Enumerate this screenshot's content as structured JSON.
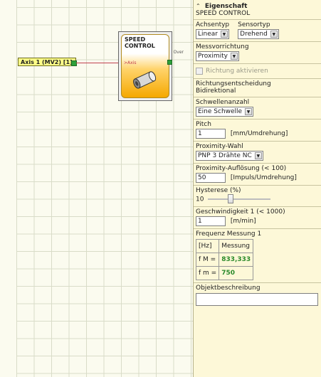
{
  "canvas": {
    "input_tag": "Axis 1 (MV2) [1]",
    "block": {
      "title_line1": "SPEED",
      "title_line2": "CONTROL",
      "input_pin": "Axis",
      "output_pin": "Over"
    }
  },
  "panel": {
    "header": {
      "collapse_icon": "chevron-up-icon",
      "title": "Eigenschaft",
      "subtitle": "SPEED CONTROL"
    },
    "achsentyp": {
      "label": "Achsentyp",
      "value": "Linear"
    },
    "sensortyp": {
      "label": "Sensortyp",
      "value": "Drehend"
    },
    "messvorrichtung": {
      "label": "Messvorrichtung",
      "value": "Proximity"
    },
    "richtung": {
      "label": "Richtung aktivieren",
      "checked": false,
      "enabled": false
    },
    "richtungsentscheidung": {
      "label": "Richtungsentscheidung",
      "value": "Bidirektional"
    },
    "schwellenanzahl": {
      "label": "Schwellenanzahl",
      "value": "Eine Schwelle"
    },
    "pitch": {
      "label": "Pitch",
      "value": "1",
      "unit": "[mm/Umdrehung]"
    },
    "proximity_wahl": {
      "label": "Proximity-Wahl",
      "value": "PNP 3 Drähte NC"
    },
    "aufloesung": {
      "label": "Proximity-Auflösung  (< 100)",
      "value": "50",
      "unit": "[Impuls/Umdrehung]"
    },
    "hysterese": {
      "label": "Hysterese (%)",
      "value": "10",
      "slider_fraction": 0.35
    },
    "geschwindigkeit": {
      "label": "Geschwindigkeit 1  (< 1000)",
      "value": "1",
      "unit": "[m/min]"
    },
    "frequenz": {
      "label": "Frequenz Messung 1",
      "unit_header": "[Hz]",
      "col_header": "Messung",
      "row1_label": "f M =",
      "row1_value": "833,333",
      "row2_label": "f m =",
      "row2_value": "750"
    },
    "objektbeschreibung": {
      "label": "Objektbeschreibung",
      "value": ""
    }
  },
  "colors": {
    "input_tag_bg": "#ffff88",
    "block_fill": "#f5a800",
    "port_green": "#2ea03a",
    "wire": "#c0404f",
    "value_green": "#2a8a2a"
  }
}
